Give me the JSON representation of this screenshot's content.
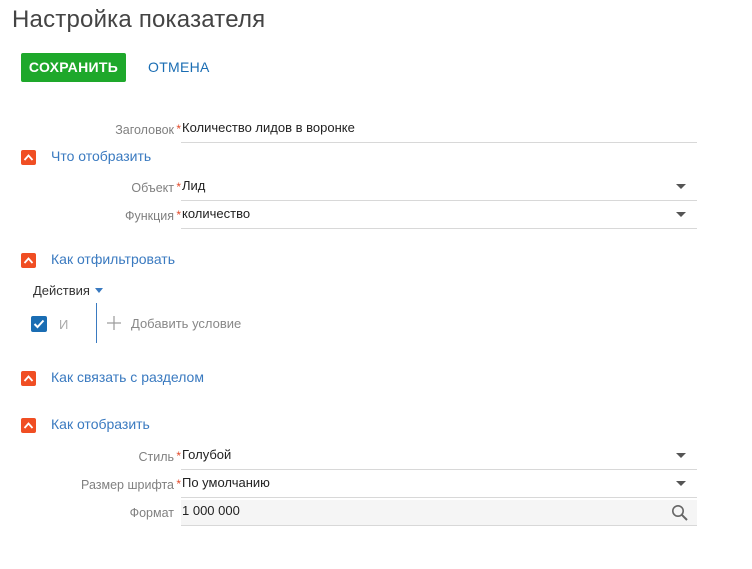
{
  "page": {
    "title": "Настройка показателя"
  },
  "toolbar": {
    "save_label": "СОХРАНИТЬ",
    "cancel_label": "ОТМЕНА"
  },
  "header_field": {
    "label": "Заголовок",
    "value": "Количество лидов в воронке"
  },
  "sections": {
    "what": {
      "title": "Что отобразить",
      "object": {
        "label": "Объект",
        "value": "Лид"
      },
      "function": {
        "label": "Функция",
        "value": "количество"
      }
    },
    "filter": {
      "title": "Как отфильтровать",
      "actions_label": "Действия",
      "logic_label": "И",
      "add_condition_label": "Добавить условие"
    },
    "link": {
      "title": "Как связать с разделом"
    },
    "display": {
      "title": "Как отобразить",
      "style": {
        "label": "Стиль",
        "value": "Голубой"
      },
      "font_size": {
        "label": "Размер шрифта",
        "value": "По умолчанию"
      },
      "format": {
        "label": "Формат",
        "value": "1 000 000"
      }
    }
  },
  "required_mark": "*",
  "colors": {
    "save": "#1ea82b",
    "link": "#1a6db3",
    "section_toggle": "#f04e23",
    "section_title": "#3a7ac0"
  },
  "icons": {
    "section_toggle": "chevron-up-icon",
    "dropdown": "caret-down-icon",
    "format_lookup": "search-icon",
    "add": "plus-icon",
    "checkbox": "check-icon"
  }
}
